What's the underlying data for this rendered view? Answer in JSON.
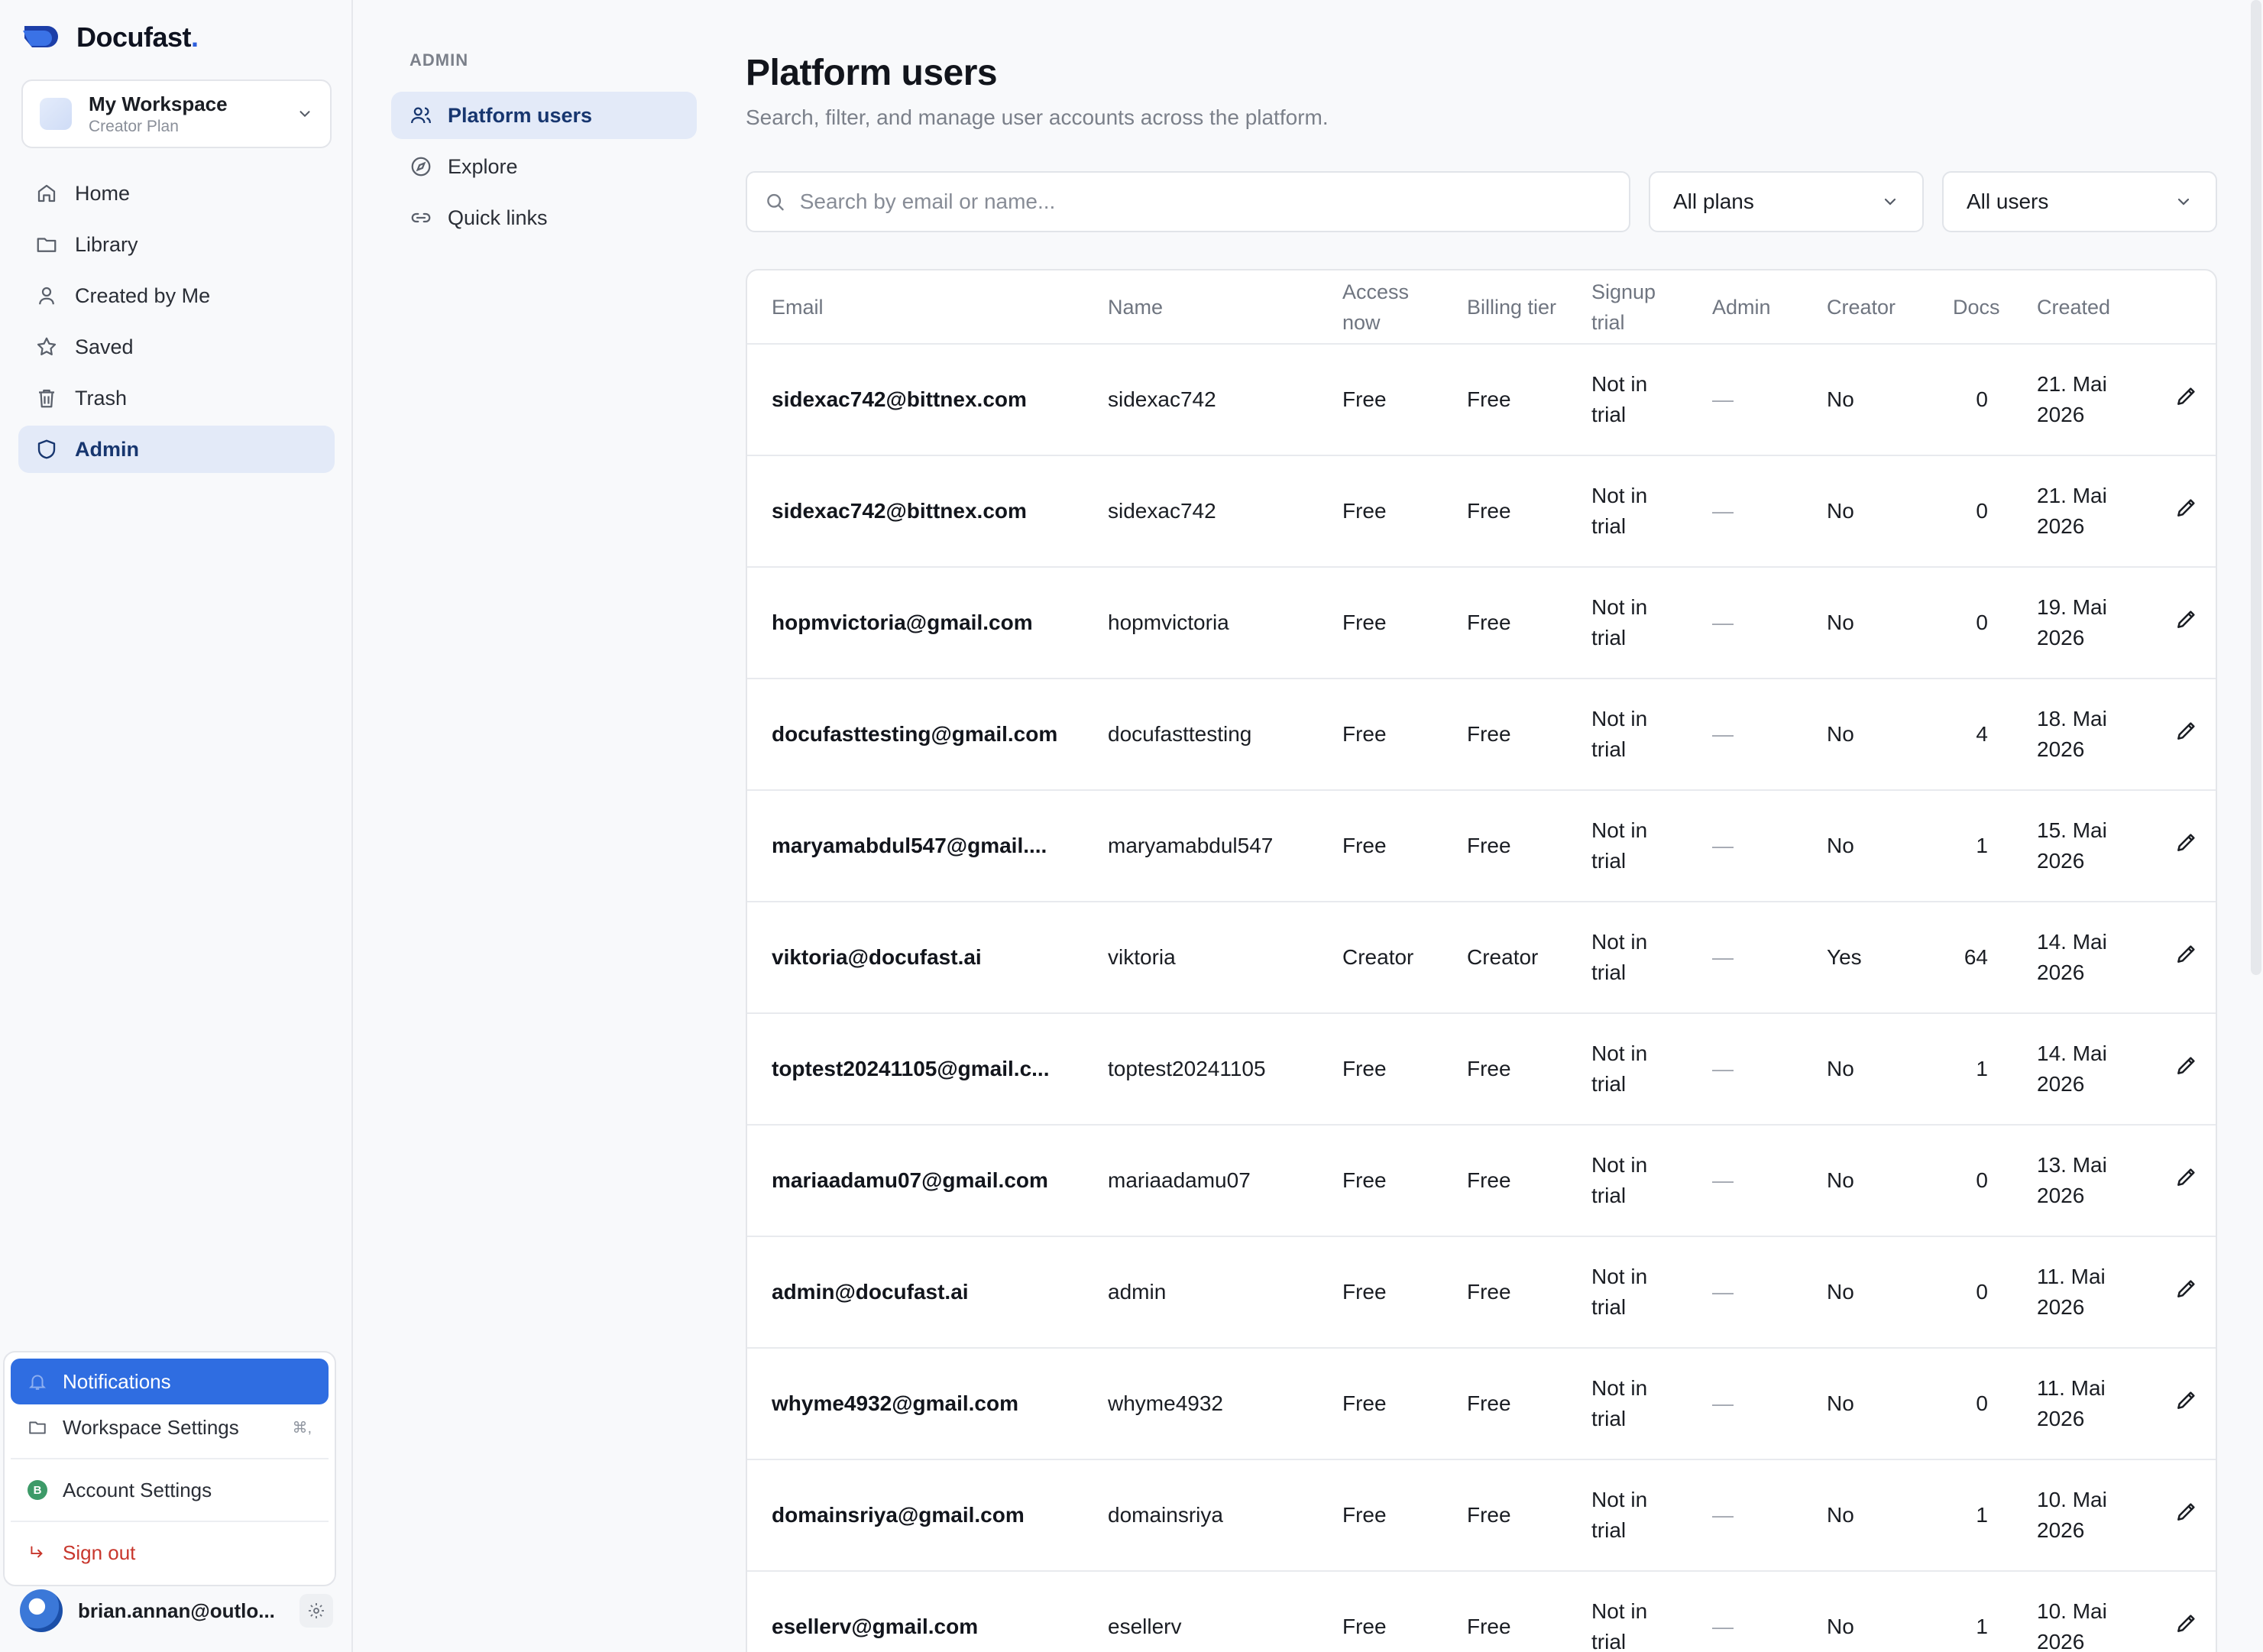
{
  "brand": {
    "name": "Docufast",
    "dot": "."
  },
  "workspace": {
    "name": "My Workspace",
    "plan": "Creator Plan"
  },
  "sidebar": {
    "items": [
      {
        "label": "Home",
        "icon": "home-icon"
      },
      {
        "label": "Library",
        "icon": "folder-icon"
      },
      {
        "label": "Created by Me",
        "icon": "user-icon"
      },
      {
        "label": "Saved",
        "icon": "star-icon"
      },
      {
        "label": "Trash",
        "icon": "trash-icon"
      },
      {
        "label": "Admin",
        "icon": "shield-icon",
        "active": true
      }
    ]
  },
  "popover": {
    "notifications": "Notifications",
    "workspace_settings": "Workspace Settings",
    "workspace_settings_kbd": "⌘,",
    "account_settings": "Account Settings",
    "account_initial": "B",
    "sign_out": "Sign out"
  },
  "user": {
    "email": "brian.annan@outlo..."
  },
  "subnav": {
    "heading": "ADMIN",
    "items": [
      {
        "label": "Platform users",
        "icon": "users-icon",
        "active": true
      },
      {
        "label": "Explore",
        "icon": "compass-icon"
      },
      {
        "label": "Quick links",
        "icon": "link-icon"
      }
    ]
  },
  "main": {
    "title": "Platform users",
    "subtitle": "Search, filter, and manage user accounts across the platform.",
    "search_placeholder": "Search by email or name...",
    "plan_filter": "All plans",
    "user_filter": "All users"
  },
  "table": {
    "headers": {
      "email": "Email",
      "name": "Name",
      "access_now": "Access now",
      "billing_tier": "Billing tier",
      "signup_trial": "Signup trial",
      "admin": "Admin",
      "creator": "Creator",
      "docs": "Docs",
      "created": "Created"
    },
    "rows": [
      {
        "email": "sidexac742@bittnex.com",
        "name": "sidexac742",
        "access": "Free",
        "billing": "Free",
        "trial": "Not in trial",
        "admin": "—",
        "creator": "No",
        "docs": "0",
        "created": "21. Mai 2026"
      },
      {
        "email": "sidexac742@bittnex.com",
        "name": "sidexac742",
        "access": "Free",
        "billing": "Free",
        "trial": "Not in trial",
        "admin": "—",
        "creator": "No",
        "docs": "0",
        "created": "21. Mai 2026"
      },
      {
        "email": "hopmvictoria@gmail.com",
        "name": "hopmvictoria",
        "access": "Free",
        "billing": "Free",
        "trial": "Not in trial",
        "admin": "—",
        "creator": "No",
        "docs": "0",
        "created": "19. Mai 2026"
      },
      {
        "email": "docufasttesting@gmail.com",
        "name": "docufasttesting",
        "access": "Free",
        "billing": "Free",
        "trial": "Not in trial",
        "admin": "—",
        "creator": "No",
        "docs": "4",
        "created": "18. Mai 2026"
      },
      {
        "email": "maryamabdul547@gmail....",
        "name": "maryamabdul547",
        "access": "Free",
        "billing": "Free",
        "trial": "Not in trial",
        "admin": "—",
        "creator": "No",
        "docs": "1",
        "created": "15. Mai 2026"
      },
      {
        "email": "viktoria@docufast.ai",
        "name": "viktoria",
        "access": "Creator",
        "billing": "Creator",
        "trial": "Not in trial",
        "admin": "—",
        "creator": "Yes",
        "docs": "64",
        "created": "14. Mai 2026"
      },
      {
        "email": "toptest20241105@gmail.c...",
        "name": "toptest20241105",
        "access": "Free",
        "billing": "Free",
        "trial": "Not in trial",
        "admin": "—",
        "creator": "No",
        "docs": "1",
        "created": "14. Mai 2026"
      },
      {
        "email": "mariaadamu07@gmail.com",
        "name": "mariaadamu07",
        "access": "Free",
        "billing": "Free",
        "trial": "Not in trial",
        "admin": "—",
        "creator": "No",
        "docs": "0",
        "created": "13. Mai 2026"
      },
      {
        "email": "admin@docufast.ai",
        "name": "admin",
        "access": "Free",
        "billing": "Free",
        "trial": "Not in trial",
        "admin": "—",
        "creator": "No",
        "docs": "0",
        "created": "11. Mai 2026"
      },
      {
        "email": "whyme4932@gmail.com",
        "name": "whyme4932",
        "access": "Free",
        "billing": "Free",
        "trial": "Not in trial",
        "admin": "—",
        "creator": "No",
        "docs": "0",
        "created": "11. Mai 2026"
      },
      {
        "email": "domainsriya@gmail.com",
        "name": "domainsriya",
        "access": "Free",
        "billing": "Free",
        "trial": "Not in trial",
        "admin": "—",
        "creator": "No",
        "docs": "1",
        "created": "10. Mai 2026"
      },
      {
        "email": "esellerv@gmail.com",
        "name": "esellerv",
        "access": "Free",
        "billing": "Free",
        "trial": "Not in trial",
        "admin": "—",
        "creator": "No",
        "docs": "1",
        "created": "10. Mai 2026"
      }
    ]
  },
  "colors": {
    "accent": "#2f6de1",
    "active_bg": "#e3eaf8",
    "danger": "#c8372d",
    "brand": "#2d5fdc"
  }
}
